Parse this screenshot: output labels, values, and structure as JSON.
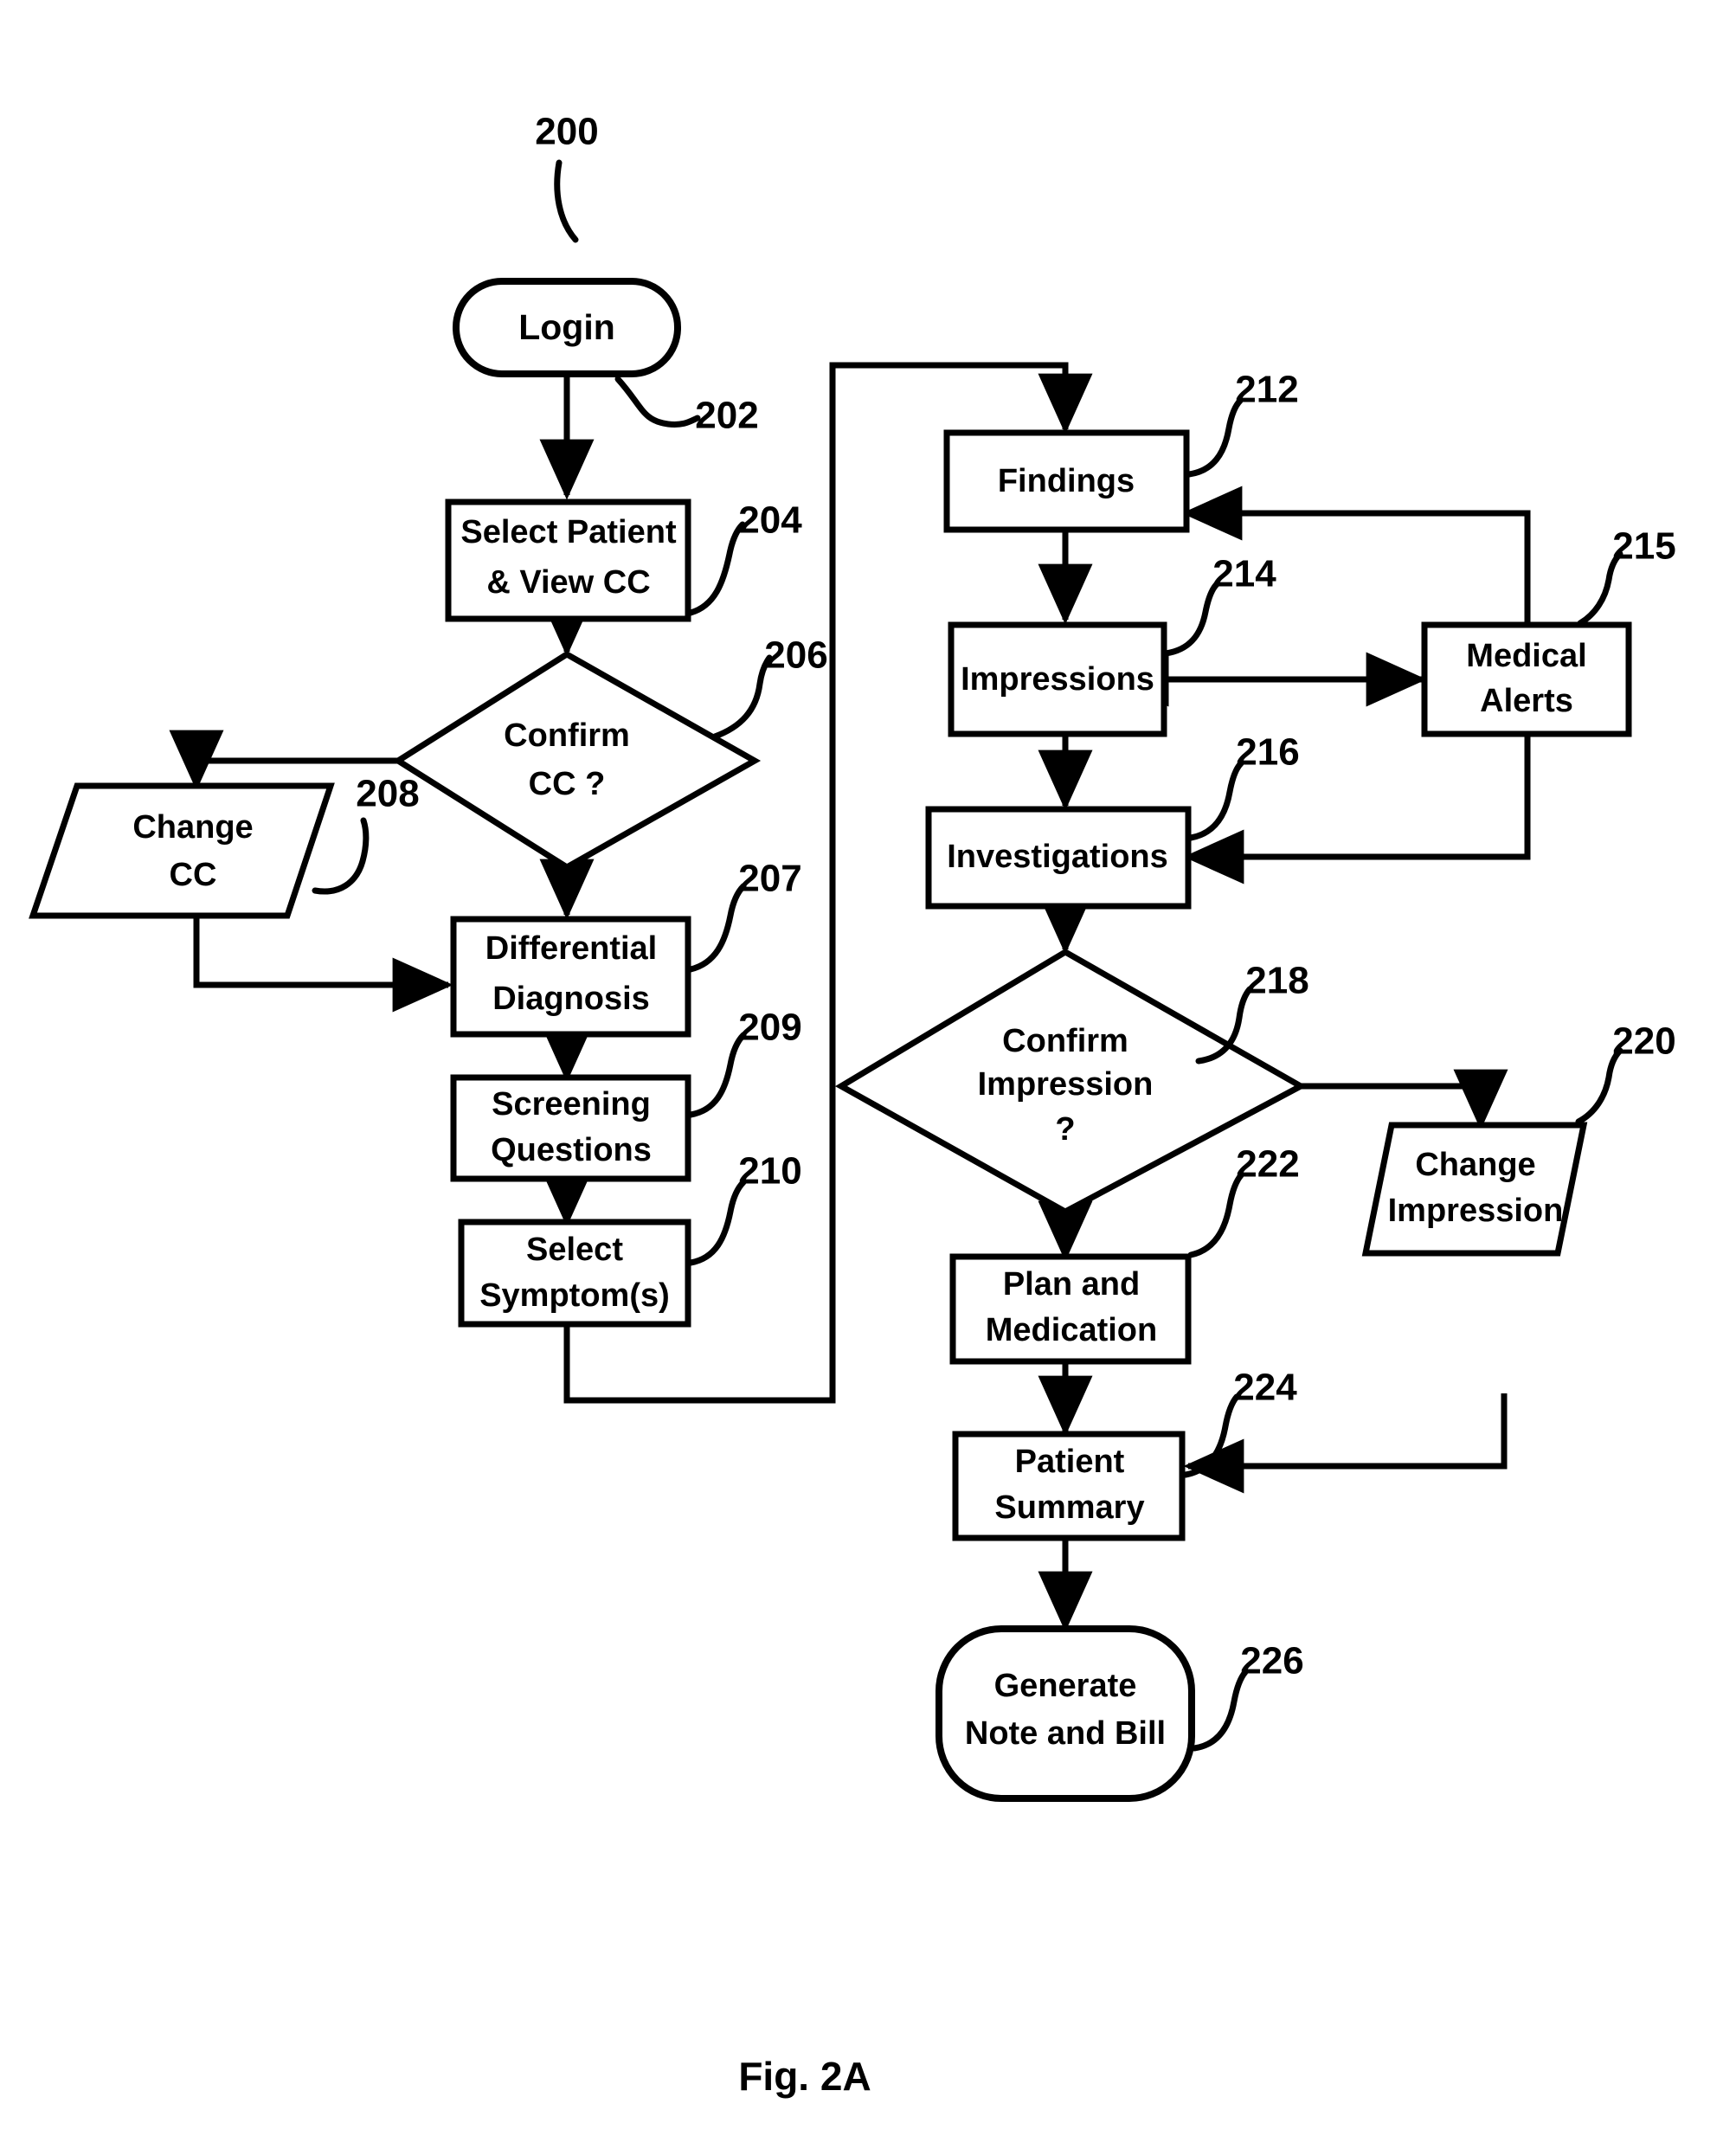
{
  "figure": {
    "caption": "Fig. 2A",
    "diagram_number": "200"
  },
  "nodes": [
    {
      "id": "login",
      "ref": "202",
      "label_lines": [
        "Login"
      ],
      "shape": "terminator"
    },
    {
      "id": "select_patient",
      "ref": "204",
      "label_lines": [
        "Select Patient",
        "& View CC"
      ],
      "shape": "process"
    },
    {
      "id": "confirm_cc",
      "ref": "206",
      "label_lines": [
        "Confirm",
        "CC ?"
      ],
      "shape": "decision"
    },
    {
      "id": "change_cc",
      "ref": "208",
      "label_lines": [
        "Change",
        "CC"
      ],
      "shape": "data"
    },
    {
      "id": "diff_diagnosis",
      "ref": "207",
      "label_lines": [
        "Differential",
        "Diagnosis"
      ],
      "shape": "process"
    },
    {
      "id": "screening",
      "ref": "209",
      "label_lines": [
        "Screening",
        "Questions"
      ],
      "shape": "process"
    },
    {
      "id": "select_symptom",
      "ref": "210",
      "label_lines": [
        "Select",
        "Symptom(s)"
      ],
      "shape": "process"
    },
    {
      "id": "findings",
      "ref": "212",
      "label_lines": [
        "Findings"
      ],
      "shape": "process"
    },
    {
      "id": "impressions",
      "ref": "214",
      "label_lines": [
        "Impressions"
      ],
      "shape": "process"
    },
    {
      "id": "medical_alerts",
      "ref": "215",
      "label_lines": [
        "Medical",
        "Alerts"
      ],
      "shape": "process"
    },
    {
      "id": "investigations",
      "ref": "216",
      "label_lines": [
        "Investigations"
      ],
      "shape": "process"
    },
    {
      "id": "confirm_impr",
      "ref": "218",
      "label_lines": [
        "Confirm",
        "Impression",
        "?"
      ],
      "shape": "decision"
    },
    {
      "id": "change_impr",
      "ref": "220",
      "label_lines": [
        "Change",
        "Impression"
      ],
      "shape": "data"
    },
    {
      "id": "plan_med",
      "ref": "222",
      "label_lines": [
        "Plan and",
        "Medication"
      ],
      "shape": "process"
    },
    {
      "id": "patient_summary",
      "ref": "224",
      "label_lines": [
        "Patient",
        "Summary"
      ],
      "shape": "process"
    },
    {
      "id": "generate_note",
      "ref": "226",
      "label_lines": [
        "Generate",
        "Note and Bill"
      ],
      "shape": "terminator"
    }
  ],
  "edges": [
    {
      "from": "login",
      "to": "select_patient",
      "arrow": "single"
    },
    {
      "from": "select_patient",
      "to": "confirm_cc",
      "arrow": "single"
    },
    {
      "from": "confirm_cc",
      "to": "change_cc",
      "arrow": "single"
    },
    {
      "from": "confirm_cc",
      "to": "diff_diagnosis",
      "arrow": "single"
    },
    {
      "from": "change_cc",
      "to": "diff_diagnosis",
      "arrow": "single"
    },
    {
      "from": "diff_diagnosis",
      "to": "screening",
      "arrow": "single"
    },
    {
      "from": "screening",
      "to": "select_symptom",
      "arrow": "single"
    },
    {
      "from": "select_symptom",
      "to": "findings",
      "arrow": "single"
    },
    {
      "from": "findings",
      "to": "impressions",
      "arrow": "single"
    },
    {
      "from": "impressions",
      "to": "medical_alerts",
      "arrow": "double"
    },
    {
      "from": "medical_alerts",
      "to": "findings",
      "arrow": "single"
    },
    {
      "from": "medical_alerts",
      "to": "investigations",
      "arrow": "single"
    },
    {
      "from": "impressions",
      "to": "investigations",
      "arrow": "single"
    },
    {
      "from": "investigations",
      "to": "confirm_impr",
      "arrow": "single"
    },
    {
      "from": "confirm_impr",
      "to": "change_impr",
      "arrow": "single"
    },
    {
      "from": "confirm_impr",
      "to": "plan_med",
      "arrow": "single"
    },
    {
      "from": "change_impr",
      "to": "plan_med",
      "arrow": "single"
    },
    {
      "from": "plan_med",
      "to": "patient_summary",
      "arrow": "single"
    },
    {
      "from": "patient_summary",
      "to": "generate_note",
      "arrow": "single"
    }
  ],
  "colors": {
    "stroke": "#000000",
    "fill": "#ffffff",
    "background": "#ffffff"
  }
}
